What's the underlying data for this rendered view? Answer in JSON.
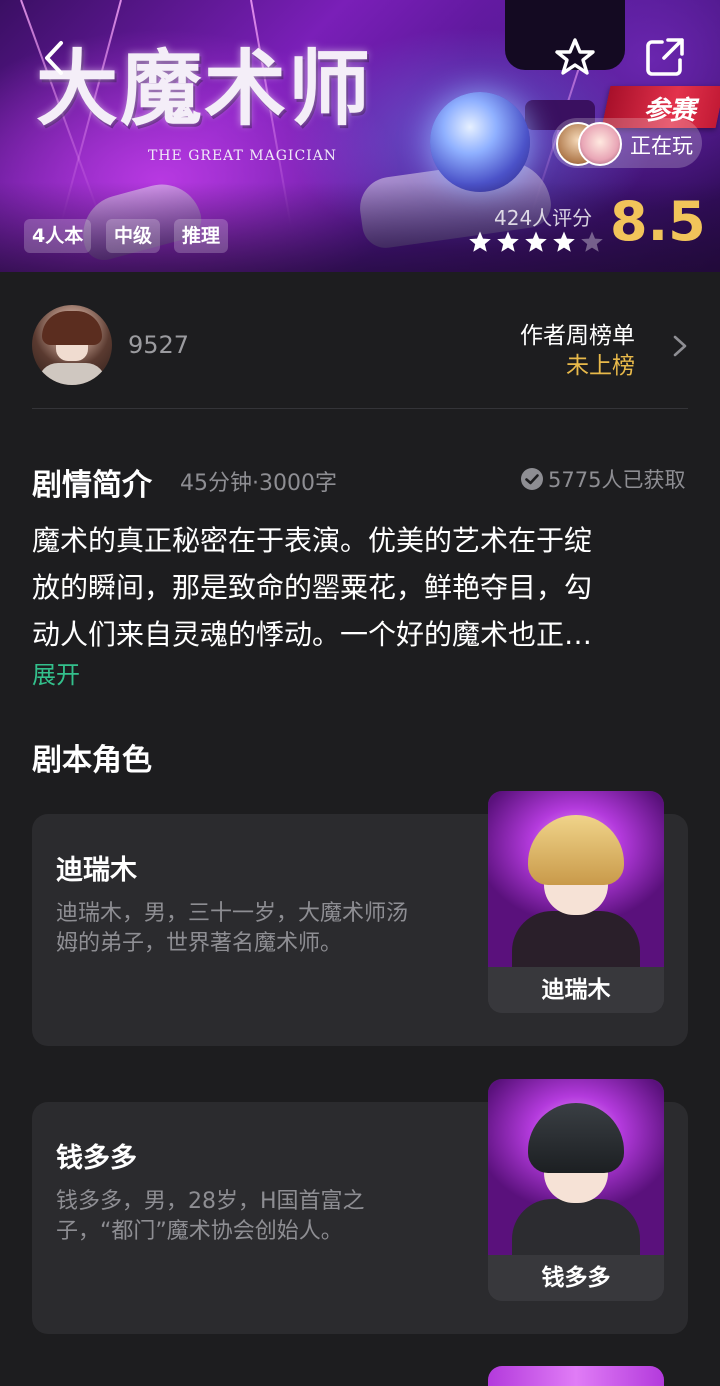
{
  "header": {
    "title_cn": "大魔术师",
    "title_en": "THE GREAT MAGICIAN",
    "contest_badge": "参赛",
    "playing_label": "正在玩",
    "tags": [
      "4人本",
      "中级",
      "推理"
    ],
    "rating_count": "424人评分",
    "rating_stars": 4,
    "rating_max": 5,
    "score": "8.5",
    "icons": {
      "back": "back-arrow-icon",
      "favorite": "star-outline-icon",
      "share": "share-icon"
    }
  },
  "author": {
    "name": "9527",
    "weekly_rank_title": "作者周榜单",
    "weekly_rank_value": "未上榜"
  },
  "synopsis": {
    "title": "剧情简介",
    "meta": "45分钟·3000字",
    "obtained": "5775人已获取",
    "lines": [
      "魔术的真正秘密在于表演。优美的艺术在于绽",
      "放的瞬间，那是致命的罂粟花，鲜艳夺目，勾",
      "动人们来自灵魂的悸动。一个好的魔术也正…"
    ],
    "expand_label": "展开"
  },
  "roles": {
    "title": "剧本角色",
    "items": [
      {
        "name": "迪瑞木",
        "desc_lines": [
          "迪瑞木，男，三十一岁，大魔术师汤",
          "姆的弟子，世界著名魔术师。"
        ],
        "portrait_label": "迪瑞木"
      },
      {
        "name": "钱多多",
        "desc_lines": [
          "钱多多，男，28岁，H国首富之",
          "子，“都门”魔术协会创始人。"
        ],
        "portrait_label": "钱多多"
      }
    ]
  },
  "colors": {
    "background": "#1d1d1f",
    "card": "#2b2b2e",
    "score": "#f2c45a",
    "rank_value": "#e8b94a",
    "expand": "#33c08c",
    "muted": "#8e8e93"
  }
}
